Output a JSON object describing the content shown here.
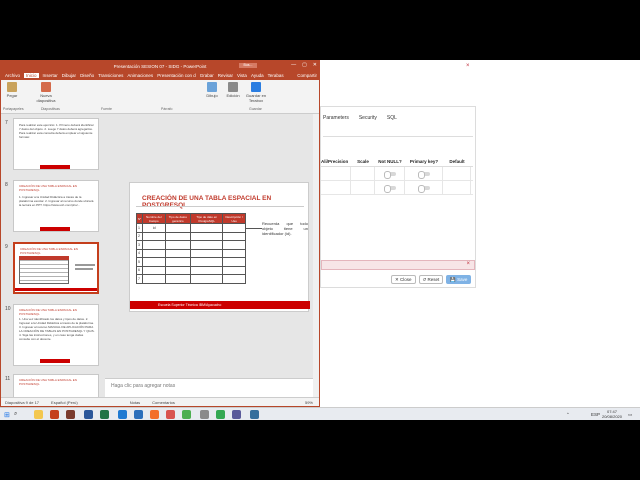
{
  "colors": {
    "accent": "#b7472a",
    "slide_red": "#c0392b",
    "save_btn": "#7fb2e5"
  },
  "pgadmin": {
    "tabs": [
      "Parameters",
      "Security",
      "SQL"
    ],
    "columns": [
      "Ali/Precision",
      "Scale",
      "Not NULL?",
      "Primary key?",
      "Default"
    ],
    "close_x": "×",
    "alert_x": "×",
    "buttons": {
      "close": "✕ Close",
      "reset": "↺ Reset",
      "save": "💾 Save"
    }
  },
  "ppt": {
    "title": "Presentación SESION 07 - SIDG  -  PowerPoint",
    "search_placeholder": "Bus...",
    "window_controls": [
      "—",
      "▢",
      "✕"
    ],
    "menu": [
      "Archivo",
      "Inicio",
      "Insertar",
      "Dibujar",
      "Diseño",
      "Transiciones",
      "Animaciones",
      "Presentación con d",
      "Grabar",
      "Revisar",
      "Vista",
      "Ayuda",
      "Terabas"
    ],
    "share": "Compartir",
    "ribbon": {
      "groups": [
        {
          "label": "Pegar",
          "icon": "paste-icon"
        },
        {
          "label": "Nueva diapositiva",
          "icon": "new-slide-icon"
        },
        {
          "label": "Dibujo",
          "icon": "draw-icon"
        },
        {
          "label": "Edición",
          "icon": "edit-icon"
        },
        {
          "label": "Guardar en Terabox",
          "icon": "save-cloud-icon"
        }
      ],
      "group_names": [
        "Portapapeles",
        "Diapositivas",
        "Fuente",
        "Párrafo",
        "Guardar"
      ]
    },
    "thumbnails": [
      {
        "num": "7",
        "heading": "",
        "text": "Para realizar este ejercicio: 1. Primero deberá identificar 7 datos del objeto. 2. Luego 7 datos deberá agregarlos. Para realizar esta consulta deberá emplear el siguiente formato:"
      },
      {
        "num": "8",
        "heading": "CREACIÓN DE UNA TABLA ESPACIAL EN POSTGRESQL",
        "text": "1. Ingresar a la Unidad Didáctica a través de la plataforma escolar. 2. Ingresar al recurso donde ubicará la lectura en PPT. https://www.ush.com/pt/u/..."
      },
      {
        "num": "9",
        "heading": "CREACIÓN DE UNA TABLA ESPACIAL EN POSTGRESQL",
        "text": ""
      },
      {
        "num": "10",
        "heading": "CREACIÓN DE UNA TABLA ESPACIAL EN POSTGRESQL",
        "text": "1. Una vez identificado los datos y tipos de datos. 2. Ingresar a la Unidad Didáctica a través de la plataforma. 3. Ingresar al recurso MANUAL DE APLICACIÓN PARA LA CREACIÓN DE TABLAS EN POSTGRESQL Y QGIS. 4. Siga las instrucciones, y en caso tenga dudas consulte con el docente."
      },
      {
        "num": "11",
        "heading": "CREACIÓN DE UNA TABLA ESPACIAL EN POSTGRESQL",
        "text": ""
      }
    ],
    "slide": {
      "title": "CREACIÓN DE UNA TABLA ESPACIAL EN POSTGRESQL",
      "table_headers": [
        "N°",
        "Nombre del Campo",
        "Tipo de datos genérico",
        "Tipo de dato en PostgreSQL",
        "Descripción / Uso"
      ],
      "first_row": [
        "1",
        "id",
        "",
        "",
        ""
      ],
      "row_numbers": [
        "1",
        "2",
        "3",
        "4",
        "5",
        "6",
        "7"
      ],
      "note": "Recuerda que todo objeto tiene un identificador (id).",
      "footer": "Escuela Superior Técnica IBM/Ayacucho"
    },
    "notes_placeholder": "Haga clic para agregar notas",
    "status": {
      "slide": "Diapositiva 9 de 17",
      "language": "Español (Perú)",
      "notes": "Notas",
      "comments": "Comentarios",
      "zoom": "59%"
    }
  },
  "taskbar": {
    "lang": "ESP",
    "time": "07:47",
    "date": "20/08/2020",
    "apps": [
      "file-explorer-icon",
      "powerpoint-icon",
      "word-icon",
      "excel-icon",
      "edge-icon",
      "brave-icon",
      "vlc-icon",
      "folder-icon",
      "chrome-icon",
      "chrome-icon",
      "pgadmin-icon",
      "store-icon"
    ]
  }
}
